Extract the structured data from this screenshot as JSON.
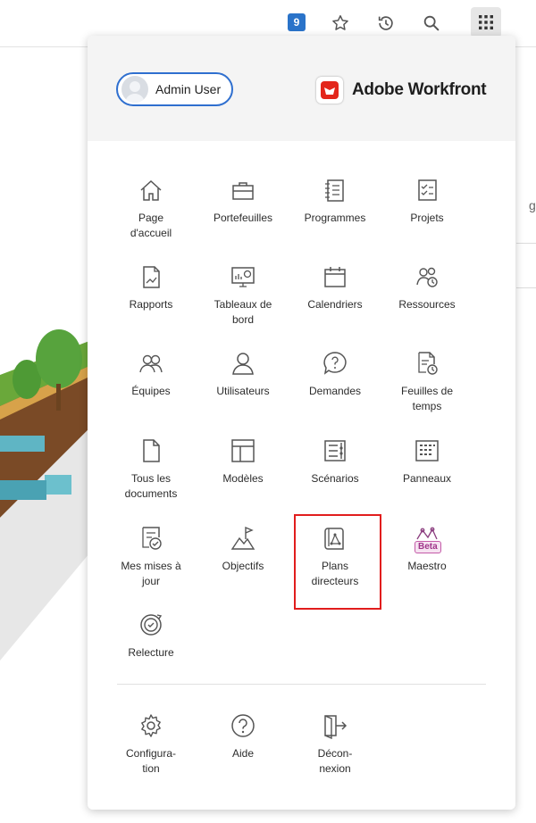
{
  "toolbar": {
    "badge_count": "9",
    "icons": [
      "extension-badge-icon",
      "star-icon",
      "history-icon",
      "search-icon",
      "apps-grid-icon"
    ]
  },
  "header": {
    "user_name": "Admin User",
    "brand_name": "Adobe Workfront",
    "brand_color": "#e3261b",
    "pill_border_color": "#2f6fcf"
  },
  "menu": {
    "items": [
      {
        "label": "Page\nd'accueil",
        "icon": "home-icon"
      },
      {
        "label": "Portefeuilles",
        "icon": "portfolio-icon"
      },
      {
        "label": "Programmes",
        "icon": "program-icon"
      },
      {
        "label": "Projets",
        "icon": "project-icon"
      },
      {
        "label": "Rapports",
        "icon": "report-icon"
      },
      {
        "label": "Tableaux de\nbord",
        "icon": "dashboard-icon"
      },
      {
        "label": "Calendriers",
        "icon": "calendar-icon"
      },
      {
        "label": "Ressources",
        "icon": "resources-icon"
      },
      {
        "label": "Équipes",
        "icon": "teams-icon"
      },
      {
        "label": "Utilisateurs",
        "icon": "user-icon"
      },
      {
        "label": "Demandes",
        "icon": "request-icon"
      },
      {
        "label": "Feuilles de\ntemps",
        "icon": "timesheet-icon"
      },
      {
        "label": "Tous les\ndocuments",
        "icon": "document-icon"
      },
      {
        "label": "Modèles",
        "icon": "template-icon"
      },
      {
        "label": "Scénarios",
        "icon": "scenario-icon"
      },
      {
        "label": "Panneaux",
        "icon": "boards-icon"
      },
      {
        "label": "Mes mises à\njour",
        "icon": "updates-icon"
      },
      {
        "label": "Objectifs",
        "icon": "goals-icon"
      },
      {
        "label": "Plans\ndirecteurs",
        "icon": "blueprint-icon"
      },
      {
        "label": "Maestro",
        "icon": "maestro-icon",
        "tag": "Beta"
      },
      {
        "label": "Relecture",
        "icon": "proof-icon"
      }
    ],
    "footer": [
      {
        "label": "Configura-\ntion",
        "icon": "gear-icon"
      },
      {
        "label": "Aide",
        "icon": "help-icon"
      },
      {
        "label": "Décon-\nnexion",
        "icon": "logout-icon"
      }
    ],
    "highlight_color": "#e11d1d"
  }
}
